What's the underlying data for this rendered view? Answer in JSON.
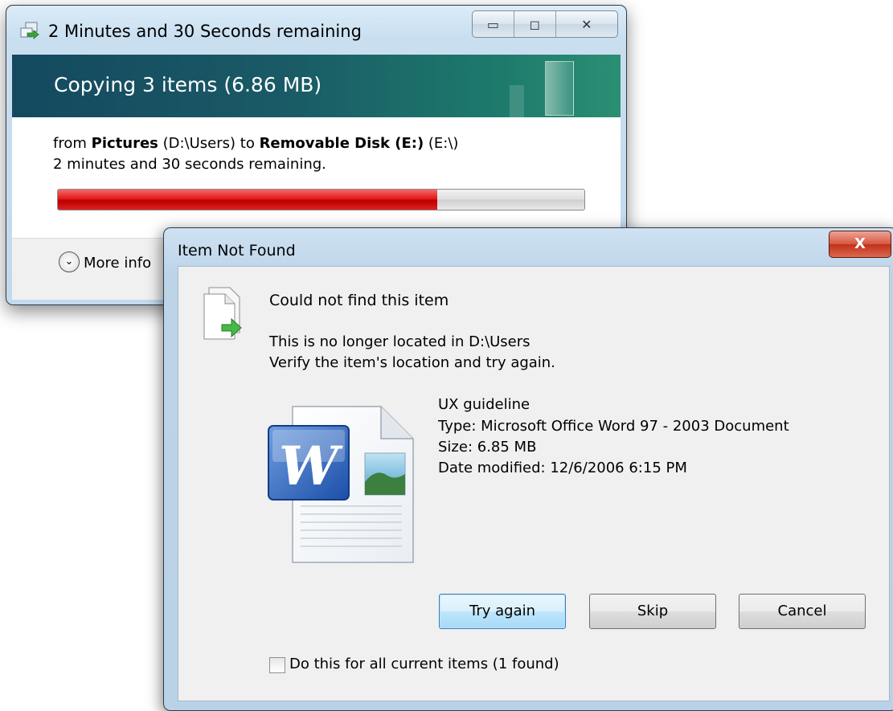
{
  "copy_window": {
    "title": "2 Minutes and 30 Seconds remaining",
    "header_caption": "Copying 3 items (6.86 MB)",
    "from_prefix": "from ",
    "from_name": "Pictures",
    "from_path": " (D:\\Users) to ",
    "to_name": "Removable Disk (E:)",
    "to_path": " (E:\\)",
    "remaining": "2 minutes and 30 seconds remaining.",
    "progress_fraction": 0.72,
    "more_info_label": "More info",
    "controls": {
      "minimize": "▭",
      "maximize": "◻",
      "close": "✕"
    }
  },
  "dialog": {
    "title": "Item Not Found",
    "close_glyph": "X",
    "heading": "Could not find this item",
    "message_line1": "This is no longer located in D:\\Users",
    "message_line2": "Verify the item's location and try again.",
    "file": {
      "name": "UX guideline",
      "type": "Type: Microsoft Office Word 97 - 2003 Document",
      "size": "Size: 6.85 MB",
      "date_modified": "Date modified: 12/6/2006 6:15 PM"
    },
    "buttons": {
      "try_again": "Try again",
      "skip": "Skip",
      "cancel": "Cancel"
    },
    "checkbox_label": "Do this for all current items (1 found)",
    "checkbox_checked": false
  },
  "colors": {
    "progress_red": "#e41a1a",
    "header_teal": "#1a5a66",
    "close_red": "#c2301a",
    "dialog_frame": "#bcd3e8"
  },
  "icons": {
    "copy_title_icon": "copy-arrow-icon",
    "more_info_icon": "chevron-down-circle-icon",
    "missing_item_icon": "document-arrow-icon",
    "file_icon": "word-document-icon"
  }
}
